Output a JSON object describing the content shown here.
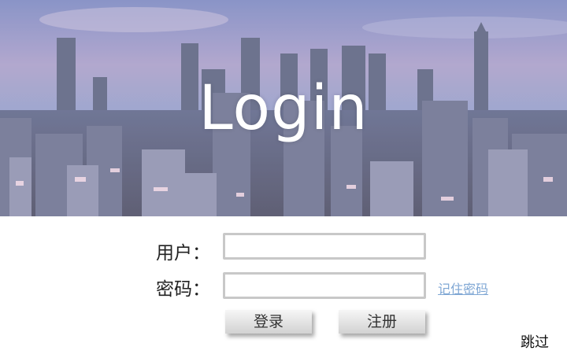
{
  "banner": {
    "title": "Login"
  },
  "form": {
    "username_label": "用户：",
    "username_value": "",
    "password_label": "密码：",
    "password_value": "",
    "remember_label": "记住密码"
  },
  "buttons": {
    "login_label": "登录",
    "register_label": "注册"
  },
  "skip_label": "跳过",
  "colors": {
    "link": "#7fa7d4",
    "field_border": "#c8c8c8",
    "banner_sky": "#7f90c4"
  }
}
